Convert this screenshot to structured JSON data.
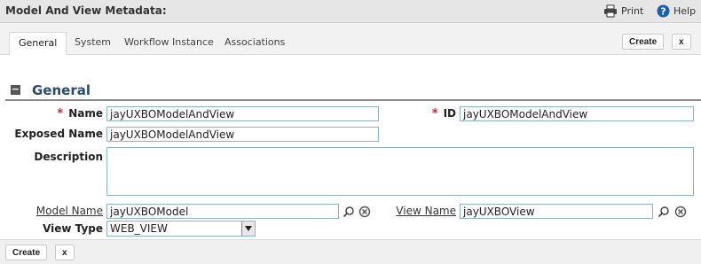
{
  "header": {
    "title": "Model And View Metadata:",
    "print_label": "Print",
    "help_label": "Help",
    "print_icon": "printer-icon",
    "help_icon": "help-icon"
  },
  "tabs": [
    {
      "label": "General",
      "active": true
    },
    {
      "label": "System",
      "active": false
    },
    {
      "label": "Workflow Instance",
      "active": false
    },
    {
      "label": "Associations",
      "active": false
    }
  ],
  "actions": {
    "create_label": "Create",
    "close_label": "x"
  },
  "section": {
    "title": "General",
    "collapse_symbol": "−"
  },
  "form": {
    "required_marker": "*",
    "name_label": "Name",
    "name_value": "jayUXBOModelAndView",
    "id_label": "ID",
    "id_value": "jayUXBOModelAndView",
    "exposed_name_label": "Exposed Name",
    "exposed_name_value": "jayUXBOModelAndView",
    "description_label": "Description",
    "description_value": "",
    "model_name_label": "Model Name",
    "model_name_value": "jayUXBOModel",
    "view_name_label": "View Name",
    "view_name_value": "jayUXBOView",
    "view_type_label": "View Type",
    "view_type_value": "WEB_VIEW"
  },
  "colors": {
    "accent": "#2d4b6b",
    "required": "#c0262d",
    "field_border": "#8db2c7",
    "help_icon": "#1f5fa8"
  }
}
